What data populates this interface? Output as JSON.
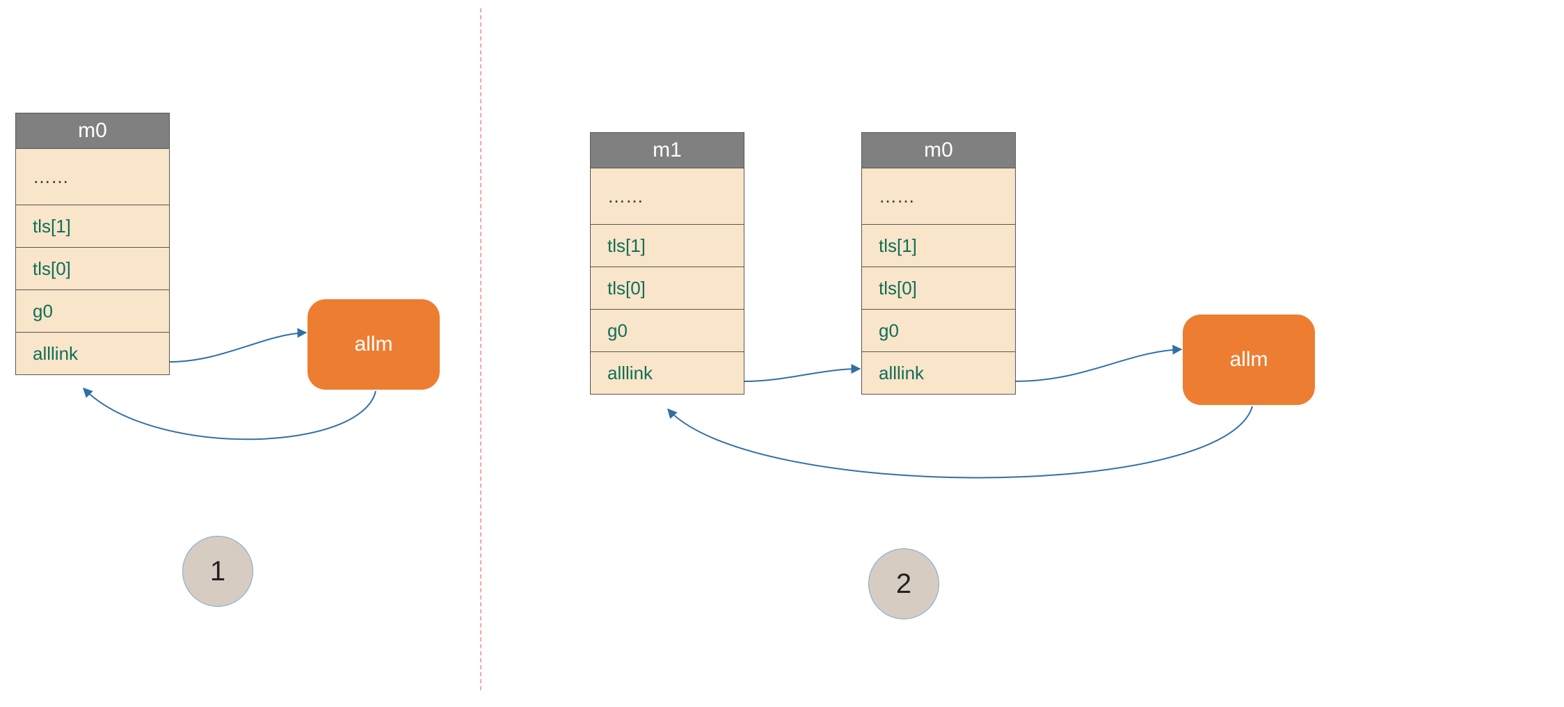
{
  "panel1": {
    "m0": {
      "title": "m0",
      "fields": [
        "……",
        "tls[1]",
        "tls[0]",
        "g0",
        "alllink"
      ]
    },
    "allm_label": "allm",
    "badge": "1"
  },
  "panel2": {
    "m1": {
      "title": "m1",
      "fields": [
        "……",
        "tls[1]",
        "tls[0]",
        "g0",
        "alllink"
      ]
    },
    "m0": {
      "title": "m0",
      "fields": [
        "……",
        "tls[1]",
        "tls[0]",
        "g0",
        "alllink"
      ]
    },
    "allm_label": "allm",
    "badge": "2"
  },
  "colors": {
    "header_bg": "#808080",
    "row_bg": "#F9E5C9",
    "field_text": "#0f6e5a",
    "allm_bg": "#ED7D31",
    "badge_bg": "#D6CCC2",
    "divider": "#f8a5a5",
    "arrow": "#2f6fa7"
  }
}
